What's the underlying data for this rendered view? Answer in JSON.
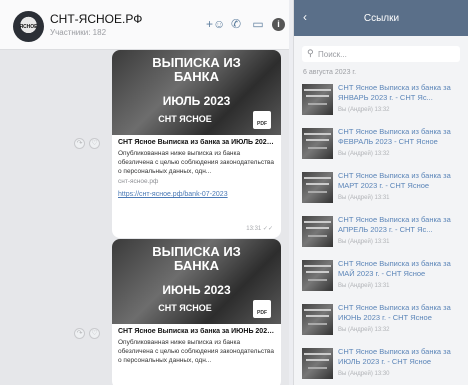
{
  "chat": {
    "title": "СНТ-ЯСНОЕ.РФ",
    "subtitle": "Участники: 182",
    "avatar_text": "ЯСНОЕ",
    "header_icons": [
      "add-user-icon",
      "phone-icon",
      "video-icon",
      "info-icon"
    ]
  },
  "messages": [
    {
      "thumb_line1": "ВЫПИСКА ИЗ",
      "thumb_line2": "БАНКА",
      "thumb_month": "ИЮЛЬ 2023",
      "thumb_footer": "СНТ ЯСНОЕ",
      "pdf": "PDF",
      "title": "СНТ Ясное Выписка из банка за ИЮЛЬ 2023...",
      "text": "Опубликованная ниже выписка из банка обезличена с целью соблюдения законодательства о персональных данных, одн...",
      "site": "снт-ясное.рф",
      "link": "https://снт-ясное.рф/bank-07-2023",
      "time": "13:31"
    },
    {
      "thumb_line1": "ВЫПИСКА ИЗ",
      "thumb_line2": "БАНКА",
      "thumb_month": "ИЮНЬ 2023",
      "thumb_footer": "СНТ ЯСНОЕ",
      "pdf": "PDF",
      "title": "СНТ Ясное Выписка из банка за ИЮНЬ 2023...",
      "text": "Опубликованная ниже выписка из банка обезличена с целью соблюдения законодательства о персональных данных, одн..."
    }
  ],
  "panel": {
    "back": "‹",
    "title": "Ссылки",
    "search_placeholder": "Поиск...",
    "date": "6 августа 2023 г.",
    "links": [
      {
        "text": "СНТ Ясное Выписка из банка за ЯНВАРЬ 2023 г. - СНТ Яс...",
        "meta": "Вы (Андрей) 13:32"
      },
      {
        "text": "СНТ Ясное Выписка из банка за ФЕВРАЛЬ 2023 - СНТ Ясное",
        "meta": "Вы (Андрей) 13:32"
      },
      {
        "text": "СНТ Ясное Выписка из банка за МАРТ 2023 г. - СНТ Ясное",
        "meta": "Вы (Андрей) 13:31"
      },
      {
        "text": "СНТ Ясное Выписка из банка за АПРЕЛЬ 2023 г. - СНТ Яс...",
        "meta": "Вы (Андрей) 13:31"
      },
      {
        "text": "СНТ Ясное Выписка из банка за МАЙ 2023 г. - СНТ Ясное",
        "meta": "Вы (Андрей) 13:31"
      },
      {
        "text": "СНТ Ясное Выписка из банка за ИЮНЬ 2023 г. - СНТ Ясное",
        "meta": "Вы (Андрей) 13:32"
      },
      {
        "text": "СНТ Ясное Выписка из банка за ИЮЛЬ 2023 г. - СНТ Ясное",
        "meta": "Вы (Андрей) 13:30"
      }
    ]
  }
}
